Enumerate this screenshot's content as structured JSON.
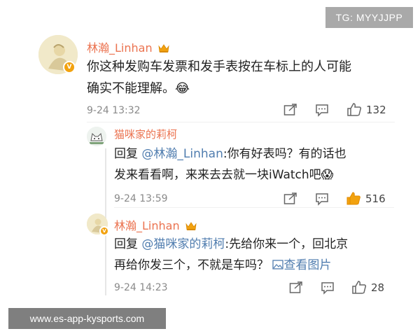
{
  "watermarks": {
    "tg": "TG: MYYJJPP",
    "site": "www.es-app-kysports.com"
  },
  "comment": {
    "username": "林瀚_Linhan",
    "text_line1": "你这种发购车发票和发手表按在车标上的人可能",
    "text_line2": "确实不能理解。",
    "emoji": "😂",
    "time": "9-24 13:32",
    "likes": "132",
    "badge_icon": "verified-v-icon",
    "crown_icon": "crown-icon"
  },
  "reply1": {
    "username": "猫咪家的莉柯",
    "prefix": "回复",
    "mention": "@林瀚_Linhan",
    "text_line1_rest": ":你有好表吗？有的话也",
    "text_line2": "发来看看啊，来来去去就一块iWatch吧",
    "emoji": "😱",
    "time": "9-24 13:59",
    "likes": "516",
    "liked_color": "#f2a20f"
  },
  "reply2": {
    "username": "林瀚_Linhan",
    "prefix": "回复",
    "mention": "@猫咪家的莉柯",
    "text_line1_rest": ":先给你来一个，回北京",
    "text_line2": "再给你发三个，不就是车吗？",
    "view_image": "查看图片",
    "time": "9-24 14:23",
    "likes": "28"
  },
  "colors": {
    "username": "#eb7350",
    "mention": "#507daf",
    "meta": "#8a8a8a"
  }
}
